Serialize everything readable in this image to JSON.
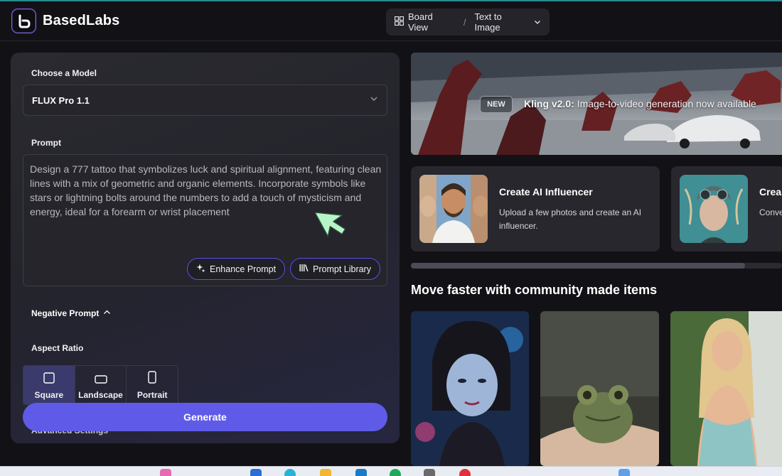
{
  "app": {
    "name": "BasedLabs"
  },
  "breadcrumb": {
    "board_view": "Board View",
    "separator": "/",
    "current": "Text to Image"
  },
  "form": {
    "model_label": "Choose a Model",
    "model_value": "FLUX Pro 1.1",
    "prompt_label": "Prompt",
    "prompt_value": "Design a 777 tattoo that symbolizes luck and spiritual alignment, featuring clean lines with a mix of geometric and organic elements. Incorporate symbols like stars or lightning bolts around the numbers to add a touch of mysticism and energy, ideal for a forearm or wrist placement",
    "enhance_label": "Enhance Prompt",
    "library_label": "Prompt Library",
    "negative_label": "Negative Prompt",
    "aspect_label": "Aspect Ratio",
    "aspects": [
      {
        "label": "Square",
        "active": true
      },
      {
        "label": "Landscape",
        "active": false
      },
      {
        "label": "Portrait",
        "active": false
      }
    ],
    "advanced_label": "Advanced Settings",
    "generate_label": "Generate"
  },
  "banner": {
    "badge": "NEW",
    "title": "Kling v2.0:",
    "text": " Image-to-video generation now available"
  },
  "cards": [
    {
      "title": "Create AI Influencer",
      "desc": "Upload a few photos and create an AI influencer."
    },
    {
      "title": "Crea",
      "desc": "Conve"
    }
  ],
  "community": {
    "title": "Move faster with community made items"
  },
  "colors": {
    "accent": "#5f5be8",
    "accent_border": "#5b4ef0",
    "background": "#121216",
    "panel": "#2a2a30"
  },
  "icons": [
    "logo-icon",
    "grid-icon",
    "chevron-down-icon",
    "sparkle-icon",
    "library-icon",
    "chevron-up-icon",
    "square-icon",
    "landscape-icon",
    "portrait-icon",
    "cursor-arrow-icon"
  ]
}
